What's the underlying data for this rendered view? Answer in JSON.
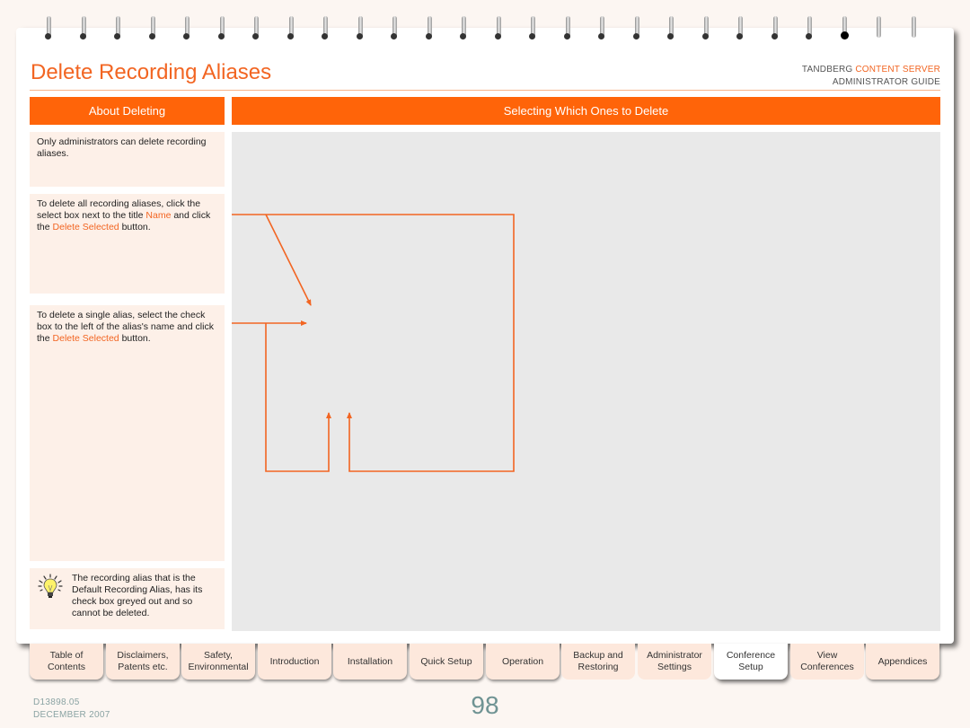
{
  "page": {
    "title": "Delete Recording Aliases",
    "brand": {
      "company": "TANDBERG",
      "product": "CONTENT SERVER",
      "guide": "ADMINISTRATOR GUIDE"
    },
    "accent_color": "#ff6409"
  },
  "left_panel": {
    "header": "About Deleting",
    "notes": [
      {
        "text": "Only administrators can delete recording aliases."
      },
      {
        "parts": [
          "To delete all recording aliases, click the select box next to the title ",
          "Name",
          " and click the ",
          "Delete Selected",
          " button."
        ]
      },
      {
        "parts": [
          "To delete a single alias, select the check box to the left of the alias's name and click the ",
          "Delete Selected",
          " button."
        ]
      }
    ],
    "tip": {
      "icon": "lightbulb-icon",
      "text": "The recording alias that is the Default Recording Alias, has its check box greyed out and so cannot be deleted."
    }
  },
  "right_panel": {
    "header": "Selecting Which Ones to Delete"
  },
  "nav_tabs": [
    {
      "label_1": "Table of",
      "label_2": "Contents",
      "active": false
    },
    {
      "label_1": "Disclaimers,",
      "label_2": "Patents etc.",
      "active": false
    },
    {
      "label_1": "Safety,",
      "label_2": "Environmental",
      "active": false
    },
    {
      "label_1": "Introduction",
      "label_2": "",
      "active": false
    },
    {
      "label_1": "Installation",
      "label_2": "",
      "active": false
    },
    {
      "label_1": "Quick Setup",
      "label_2": "",
      "active": false
    },
    {
      "label_1": "Operation",
      "label_2": "",
      "active": false
    },
    {
      "label_1": "Backup and",
      "label_2": "Restoring",
      "active": false
    },
    {
      "label_1": "Administrator",
      "label_2": "Settings",
      "active": false
    },
    {
      "label_1": "Conference",
      "label_2": "Setup",
      "active": true
    },
    {
      "label_1": "View",
      "label_2": "Conferences",
      "active": false
    },
    {
      "label_1": "Appendices",
      "label_2": "",
      "active": false
    }
  ],
  "footer": {
    "doc_id": "D13898.05",
    "date": "DECEMBER 2007",
    "page_number": "98"
  }
}
